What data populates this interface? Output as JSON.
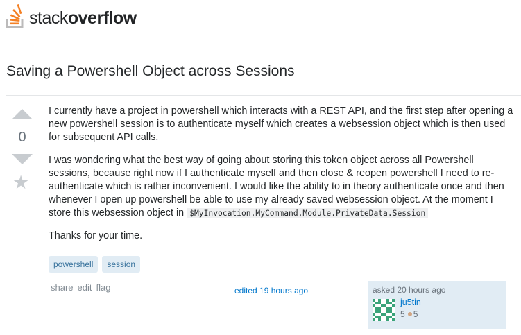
{
  "brand": {
    "logo_part1": "stack",
    "logo_part2": "overflow",
    "logo_icon": "stack-overflow-logo-icon"
  },
  "question": {
    "title": "Saving a Powershell Object across Sessions",
    "vote_count": "0",
    "paragraphs": [
      "I currently have a project in powershell which interacts with a REST API, and the first step after opening a new powershell session is to authenticate myself which creates a websession object which is then used for subsequent API calls.",
      "I was wondering what the best way of going about storing this token object across all Powershell sessions, because right now if I authenticate myself and then close & reopen powershell I need to re-authenticate which is rather inconvenient. I would like the ability to in theory authenticate once and then whenever I open up powershell be able to use my already saved websession object. At the moment I store this websession object in",
      "Thanks for your time."
    ],
    "code_snippet": "$MyInvocation.MyCommand.Module.PrivateData.Session",
    "tags": [
      "powershell",
      "session"
    ],
    "menu": {
      "share": "share",
      "edit": "edit",
      "flag": "flag"
    },
    "edited": "edited 19 hours ago",
    "owner": {
      "asked": "asked 20 hours ago",
      "name": "ju5tin",
      "reputation": "5",
      "bronze_badges": "5",
      "badge_color": "#d1a684"
    }
  },
  "icons": {
    "upvote": "upvote-arrow-icon",
    "downvote": "downvote-arrow-icon",
    "favorite": "star-icon"
  }
}
